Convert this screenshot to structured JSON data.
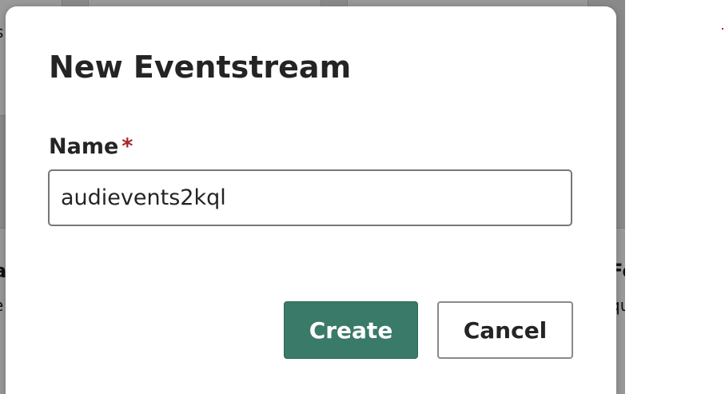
{
  "dialog": {
    "title": "New Eventstream",
    "name_label": "Name",
    "required_marker": "*",
    "name_value": "audievents2kql",
    "create_label": "Create",
    "cancel_label": "Cancel"
  },
  "background": {
    "left_heading_fragment": "s",
    "left_bold_fragment": "al",
    "left_small_fragment": "e",
    "right_bold_fragment": "Fo",
    "right_small_fragment": "qu"
  },
  "colors": {
    "primary_button": "#3a7a68",
    "required_star": "#a4262c",
    "overlay": "#8a8a8a"
  }
}
